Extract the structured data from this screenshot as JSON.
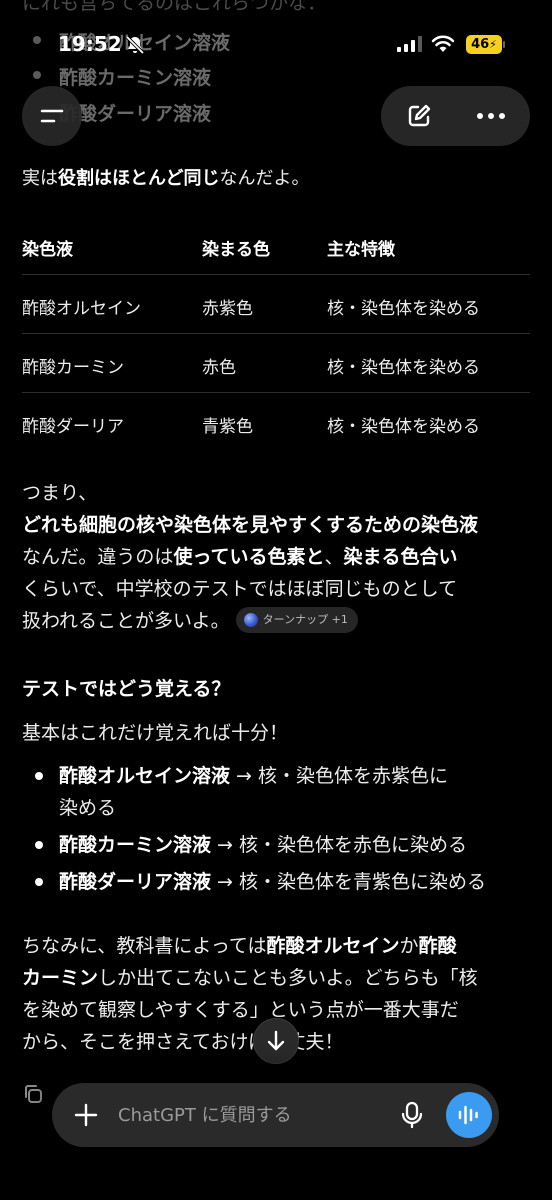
{
  "status": {
    "time": "19:52",
    "battery": "46"
  },
  "ghost": {
    "top_line": "にれも営ちてるのはこれらつかな：",
    "items": [
      "酢酸オルセイン溶液",
      "酢酸カーミン溶液",
      "酢酸ダーリア溶液"
    ]
  },
  "intro": {
    "pre": "実は",
    "bold": "役割はほとんど同じ",
    "post": "なんだよ。"
  },
  "table": {
    "headers": [
      "染色液",
      "染まる色",
      "主な特徴"
    ],
    "rows": [
      [
        "酢酸オルセイン",
        "赤紫色",
        "核・染色体を染める"
      ],
      [
        "酢酸カーミン",
        "赤色",
        "核・染色体を染める"
      ],
      [
        "酢酸ダーリア",
        "青紫色",
        "核・染色体を染める"
      ]
    ]
  },
  "summary": {
    "l1": "つまり、",
    "l2_bold": "どれも細胞の核や染色体を見やすくするための染色液",
    "l3_a": "なんだ。違うのは",
    "l3_b": "使っている色素と",
    "l3_c": "、",
    "l3_d": "染まる色合い",
    "l4": "くらいで、中学校のテストではほぼ同じものとして",
    "l5": "扱われることが多いよ。",
    "chip": "ターンナップ +1"
  },
  "test_section": {
    "heading": "テストではどう覚える？",
    "intro": "基本はこれだけ覚えれば十分！",
    "items": [
      {
        "bold": "酢酸オルセイン溶液",
        "text": " → 核・染色体を赤紫色に",
        "text2": "染める"
      },
      {
        "bold": "酢酸カーミン溶液",
        "text": " → 核・染色体を赤色に染める"
      },
      {
        "bold": "酢酸ダーリア溶液",
        "text": " → 核・染色体を青紫色に染める"
      }
    ]
  },
  "closing": {
    "a1": "ちなみに、教科書によっては",
    "b1": "酢酸オルセイン",
    "a2": "か",
    "b2": "酢酸",
    "b3": "カーミン",
    "a3": "しか出てこないことも多いよ。どちらも「核",
    "l3": "を染めて観察しやすくする」という点が一番大事だ",
    "l4": "から、そこを押さえておけば大丈夫！"
  },
  "composer": {
    "placeholder": "ChatGPT に質問する"
  },
  "icons": [
    "bell-slash-icon",
    "signal-icon",
    "wifi-icon",
    "menu-icon",
    "edit-icon",
    "more-icon",
    "arrow-down-icon",
    "copy-icon",
    "plus-icon",
    "mic-icon",
    "voice-wave-icon"
  ],
  "colors": {
    "background": "#000000",
    "voice_button": "#3a9bf0",
    "battery": "#f5d020"
  }
}
